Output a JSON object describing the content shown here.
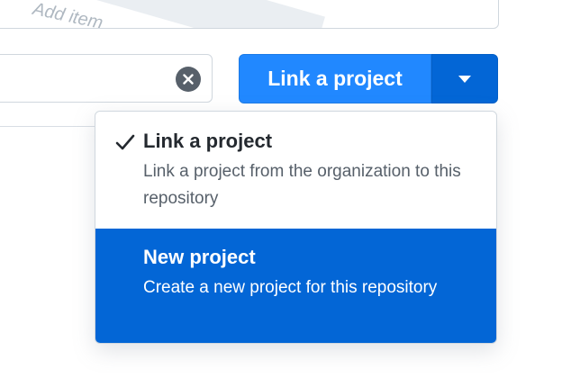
{
  "top_card": {
    "placeholder_fragment": "Add item"
  },
  "search": {
    "value": "",
    "placeholder": ""
  },
  "split_button": {
    "label": "Link a project"
  },
  "menu": {
    "items": [
      {
        "title": "Link a project",
        "description": "Link a project from the organization to this repository",
        "checked": true,
        "selected": false
      },
      {
        "title": "New project",
        "description": "Create a new project for this repository",
        "checked": false,
        "selected": true
      }
    ]
  },
  "colors": {
    "primary": "#2188ff",
    "primary_dark": "#0366d6",
    "text": "#24292f",
    "muted": "#57606a",
    "border": "#d0d7de"
  },
  "icons": {
    "clear": "x-circle-icon",
    "caret": "triangle-down-icon",
    "check": "check-icon"
  }
}
